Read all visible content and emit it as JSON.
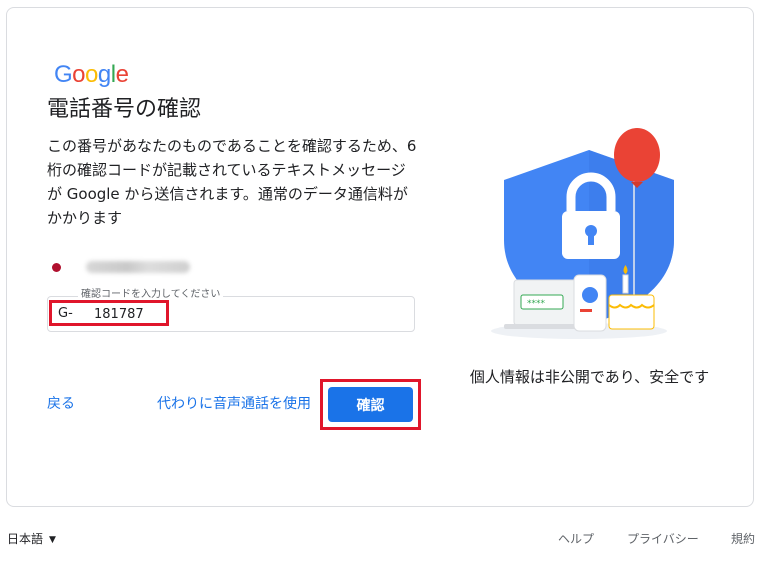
{
  "logo": {
    "letters": [
      "G",
      "o",
      "o",
      "g",
      "l",
      "e"
    ],
    "colors": [
      "#4285F4",
      "#EA4335",
      "#FBBC05",
      "#4285F4",
      "#34A853",
      "#EA4335"
    ]
  },
  "title": "電話番号の確認",
  "description": "この番号があなたのものであることを確認するため、6 桁の確認コードが記載されているテキストメッセージが Google から送信されます。通常のデータ通信料がかかります",
  "phone": {
    "icon": "flag-dot-icon",
    "number_value": ""
  },
  "code_field": {
    "label": "確認コードを入力してください",
    "prefix": "G-",
    "value": "181787"
  },
  "actions": {
    "back": "戻る",
    "voice_call": "代わりに音声通話を使用",
    "confirm": "確認"
  },
  "illustration": {
    "caption": "個人情報は非公開であり、安全です",
    "password_mask": "****"
  },
  "footer": {
    "language": "日本語",
    "help": "ヘルプ",
    "privacy": "プライバシー",
    "terms": "規約"
  },
  "colors": {
    "accent": "#1a73e8",
    "highlight": "#e0162b",
    "shield": "#4285F4",
    "balloon": "#EA4335"
  }
}
